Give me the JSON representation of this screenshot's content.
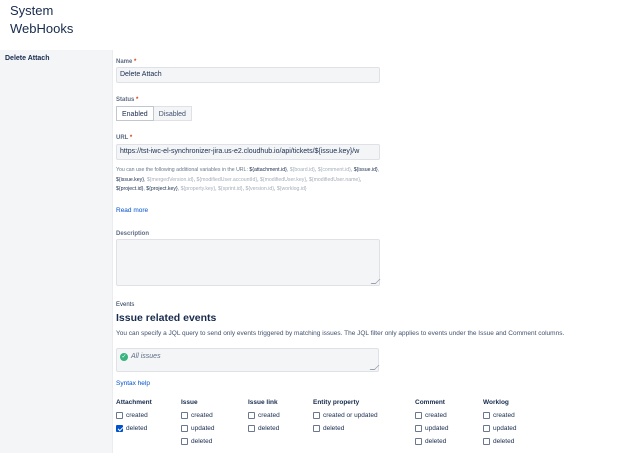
{
  "header": {
    "title_line1": "System",
    "title_line2": "WebHooks"
  },
  "sidebar": {
    "items": [
      {
        "label": "Delete Attach"
      }
    ]
  },
  "form": {
    "name": {
      "label": "Name",
      "required": "*",
      "value": "Delete Attach"
    },
    "status": {
      "label": "Status",
      "required": "*",
      "options": [
        "Enabled",
        "Disabled"
      ],
      "selected": "Enabled"
    },
    "url": {
      "label": "URL",
      "required": "*",
      "value": "https://tst-iwc-el-synchronizer-jira.us-e2.cloudhub.io/api/tickets/${issue.key}/w",
      "help_intro": "You can use the following additional variables in the URL: ",
      "variables": [
        {
          "text": "${attachment.id}",
          "style": "v"
        },
        {
          "text": "${board.id}",
          "style": "m"
        },
        {
          "text": "${comment.id}",
          "style": "m"
        },
        {
          "text": "${issue.id}",
          "style": "v"
        },
        {
          "text": "${issue.key}",
          "style": "v"
        },
        {
          "text": "${mergedVersion.id}",
          "style": "m"
        },
        {
          "text": "${modifiedUser.accountId}",
          "style": "m"
        },
        {
          "text": "${modifiedUser.key}",
          "style": "m"
        },
        {
          "text": "${modifiedUser.name}",
          "style": "m"
        },
        {
          "text": "${project.id}",
          "style": "v"
        },
        {
          "text": "${project.key}",
          "style": "v"
        },
        {
          "text": "${property.key}",
          "style": "m"
        },
        {
          "text": "${sprint.id}",
          "style": "m"
        },
        {
          "text": "${version.id}",
          "style": "m"
        },
        {
          "text": "${worklog.id}",
          "style": "m"
        }
      ],
      "read_more": "Read more"
    },
    "description": {
      "label": "Description",
      "value": ""
    }
  },
  "events": {
    "label": "Events",
    "heading": "Issue related events",
    "description": "You can specify a JQL query to send only events triggered by matching issues. The JQL filter only applies to events under the Issue and Comment columns.",
    "jql_value": "All issues",
    "syntax_help": "Syntax help",
    "columns": [
      {
        "title": "Attachment",
        "items": [
          {
            "label": "created",
            "checked": false
          },
          {
            "label": "deleted",
            "checked": true
          }
        ]
      },
      {
        "title": "Issue",
        "items": [
          {
            "label": "created",
            "checked": false
          },
          {
            "label": "updated",
            "checked": false
          },
          {
            "label": "deleted",
            "checked": false
          }
        ]
      },
      {
        "title": "Issue link",
        "items": [
          {
            "label": "created",
            "checked": false
          },
          {
            "label": "deleted",
            "checked": false
          }
        ]
      },
      {
        "title": "Entity property",
        "items": [
          {
            "label": "created or updated",
            "checked": false
          },
          {
            "label": "deleted",
            "checked": false
          }
        ]
      },
      {
        "title": "Comment",
        "items": [
          {
            "label": "created",
            "checked": false
          },
          {
            "label": "updated",
            "checked": false
          },
          {
            "label": "deleted",
            "checked": false
          }
        ]
      },
      {
        "title": "Worklog",
        "items": [
          {
            "label": "created",
            "checked": false
          },
          {
            "label": "updated",
            "checked": false
          },
          {
            "label": "deleted",
            "checked": false
          }
        ]
      }
    ]
  }
}
